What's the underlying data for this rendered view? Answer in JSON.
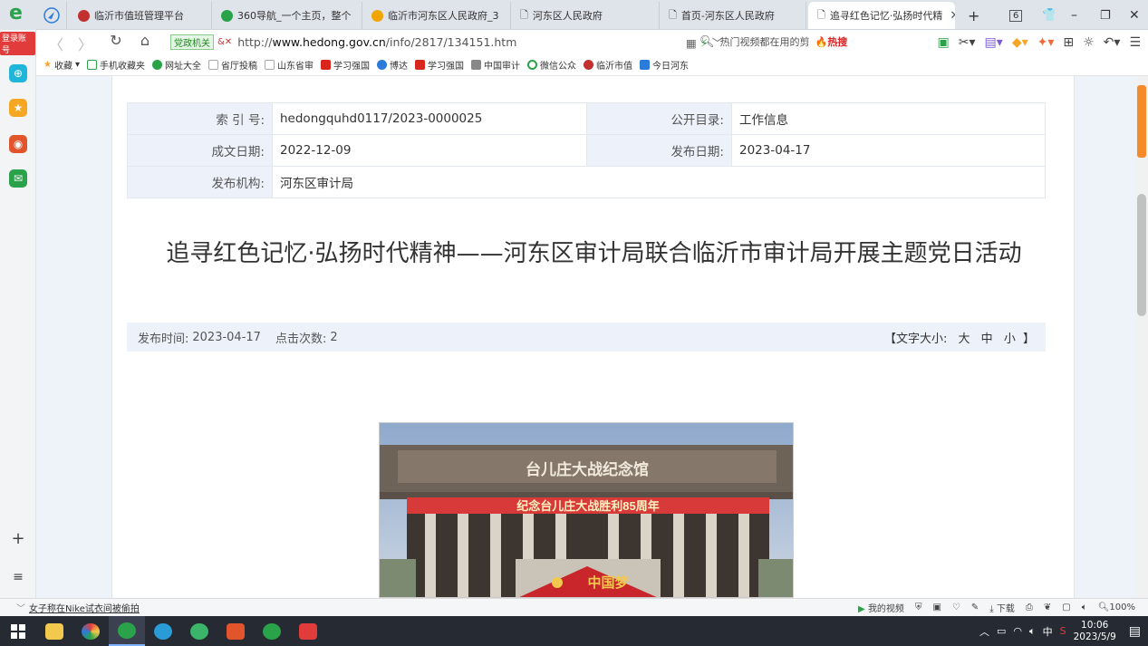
{
  "browser": {
    "tabs": [
      {
        "label": "临沂市值班管理平台",
        "color": "#c23030"
      },
      {
        "label": "360导航_一个主页，整个",
        "color": "#2aa24a"
      },
      {
        "label": "临沂市河东区人民政府_3",
        "color": "#f0a500"
      },
      {
        "label": "河东区人民政府",
        "color": "#cccccc"
      },
      {
        "label": "首页-河东区人民政府",
        "color": "#cccccc"
      },
      {
        "label": "追寻红色记忆·弘扬时代精",
        "color": "#cccccc"
      }
    ],
    "tab_count": "6",
    "badge": "党政机关",
    "url_prefix": "http://",
    "url_domain": "www.hedong.gov.cn",
    "url_path": "/info/2817/134151.htm",
    "search_placeholder": "热门视频都在用的剪",
    "hot_label": "热搜",
    "login_tag": "登录账号",
    "bookmarks": [
      {
        "label": "收藏",
        "color": "#f5a623"
      },
      {
        "label": "手机收藏夹",
        "color": "#2aa24a"
      },
      {
        "label": "网址大全",
        "color": "#2aa24a"
      },
      {
        "label": "省厅投稿",
        "color": "#dddddd"
      },
      {
        "label": "山东省审",
        "color": "#dddddd"
      },
      {
        "label": "学习强国",
        "color": "#d9261c"
      },
      {
        "label": "博达",
        "color": "#2b7bd8"
      },
      {
        "label": "学习强国",
        "color": "#d9261c"
      },
      {
        "label": "中国审计",
        "color": "#888888"
      },
      {
        "label": "微信公众",
        "color": "#2aa24a"
      },
      {
        "label": "临沂市值",
        "color": "#c23030"
      },
      {
        "label": "今日河东",
        "color": "#2b7bd8"
      }
    ]
  },
  "meta": {
    "index_label": "索 引 号:",
    "index_value": "hedongquhd0117/2023-0000025",
    "catalog_label": "公开目录:",
    "catalog_value": "工作信息",
    "written_label": "成文日期:",
    "written_value": "2022-12-09",
    "publish_label": "发布日期:",
    "publish_value": "2023-04-17",
    "org_label": "发布机构:",
    "org_value": "河东区审计局"
  },
  "article": {
    "title": "追寻红色记忆·弘扬时代精神——河东区审计局联合临沂市审计局开展主题党日活动",
    "time_label": "发布时间:",
    "time_value": "2023-04-17",
    "clicks_label": "点击次数:",
    "clicks_value": "2",
    "font_size_prefix": "【文字大小:",
    "font_big": "大",
    "font_mid": "中",
    "font_small": "小",
    "font_size_suffix": "】",
    "photo_sign": "台儿庄大战纪念馆",
    "photo_banner": "纪念台儿庄大战胜利85周年",
    "photo_dream": "中国梦"
  },
  "status": {
    "news": "女子称在Nike试衣间被偷拍",
    "my_video": "我的视频",
    "download": "下载",
    "zoom": "100%"
  },
  "taskbar": {
    "ime": "中",
    "time": "10:06",
    "date": "2023/5/9"
  }
}
